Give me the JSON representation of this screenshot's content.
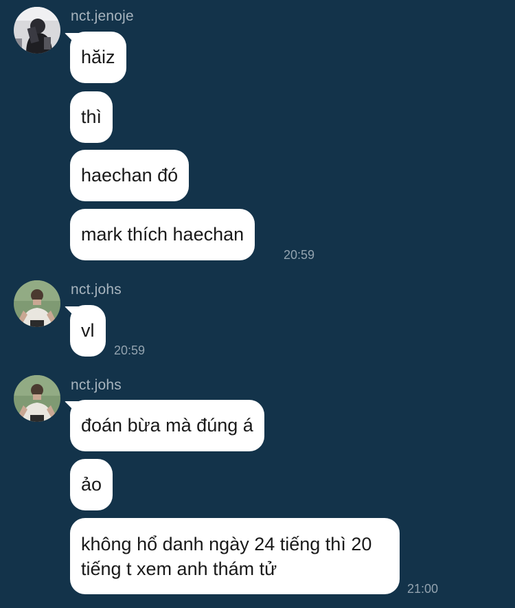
{
  "groups": [
    {
      "sender": "nct.jenoje",
      "avatar_icon": "user-avatar-dark-photo",
      "messages": [
        "hăiz",
        "thì",
        "haechan đó",
        "mark thích haechan"
      ],
      "time": "20:59"
    },
    {
      "sender": "nct.johs",
      "avatar_icon": "user-avatar-green-photo",
      "messages": [
        "vl"
      ],
      "time": "20:59"
    },
    {
      "sender": "nct.johs",
      "avatar_icon": "user-avatar-green-photo",
      "messages": [
        "đoán bừa mà đúng á",
        "ảo",
        "không hổ danh ngày 24 tiếng thì 20 tiếng t xem anh thám tử"
      ],
      "time": "21:00"
    }
  ],
  "colors": {
    "background": "#13334a",
    "bubble": "#ffffff",
    "sender_text": "#a7b4be",
    "time_text": "#93a3af"
  }
}
